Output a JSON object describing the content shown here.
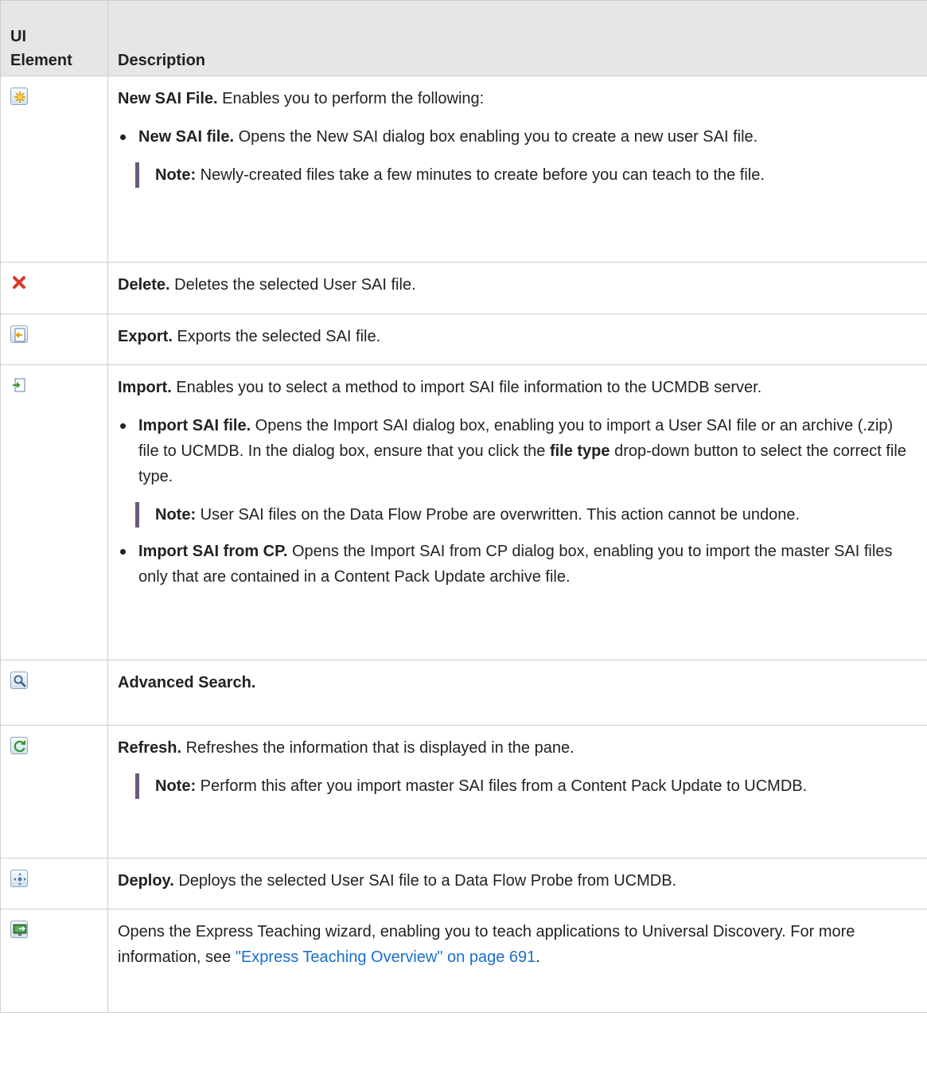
{
  "header": {
    "col1": "UI Element",
    "col2": "Description"
  },
  "rows": {
    "new_sai": {
      "icon": "new-file-star-icon",
      "title": "New SAI File.",
      "text": " Enables you to perform the following:",
      "bullet_title": "New SAI file.",
      "bullet_text": " Opens the New SAI dialog box enabling you to create a new user SAI file.",
      "note_label": "Note:",
      "note_text": "  Newly-created files take a few minutes to create before you can teach to the file."
    },
    "delete": {
      "icon": "delete-x-icon",
      "title": "Delete.",
      "text": " Deletes the selected User SAI file."
    },
    "export": {
      "icon": "export-icon",
      "title": "Export.",
      "text": " Exports the selected SAI file."
    },
    "import": {
      "icon": "import-icon",
      "title": "Import.",
      "text": " Enables you to select a method to import SAI file information to the UCMDB server.",
      "b1_title": "Import SAI file.",
      "b1_text_a": " Opens the Import SAI dialog box, enabling you to import a User SAI file or an archive (.zip) file to UCMDB. In the dialog box, ensure that you click the ",
      "b1_bold": "file type",
      "b1_text_b": " drop-down button to select the correct file type.",
      "note_label": "Note:",
      "note_text": "  User SAI files on the Data Flow Probe are overwritten. This action cannot be undone.",
      "b2_title": "Import SAI from CP.",
      "b2_text": " Opens the Import SAI from CP dialog box, enabling you to import the master SAI files only that are contained in a Content Pack Update archive file."
    },
    "search": {
      "icon": "search-icon",
      "title": "Advanced Search."
    },
    "refresh": {
      "icon": "refresh-icon",
      "title": "Refresh.",
      "text": " Refreshes the information that is displayed in the pane.",
      "note_label": "Note:",
      "note_text": "  Perform this after you import master SAI files from a Content Pack Update to UCMDB."
    },
    "deploy": {
      "icon": "deploy-icon",
      "title": "Deploy.",
      "text": " Deploys the selected User SAI file to a Data Flow Probe from UCMDB."
    },
    "express": {
      "icon": "express-teaching-icon",
      "text": "Opens the Express Teaching wizard, enabling you to teach applications to Universal Discovery. For more information, see ",
      "link": "\"Express Teaching Overview\" on page 691",
      "end": "."
    }
  },
  "colors": {
    "header_bg": "#e6e6e6",
    "border": "#cfcfcf",
    "note_bar": "#6a5a78",
    "link": "#1a6fcc"
  }
}
